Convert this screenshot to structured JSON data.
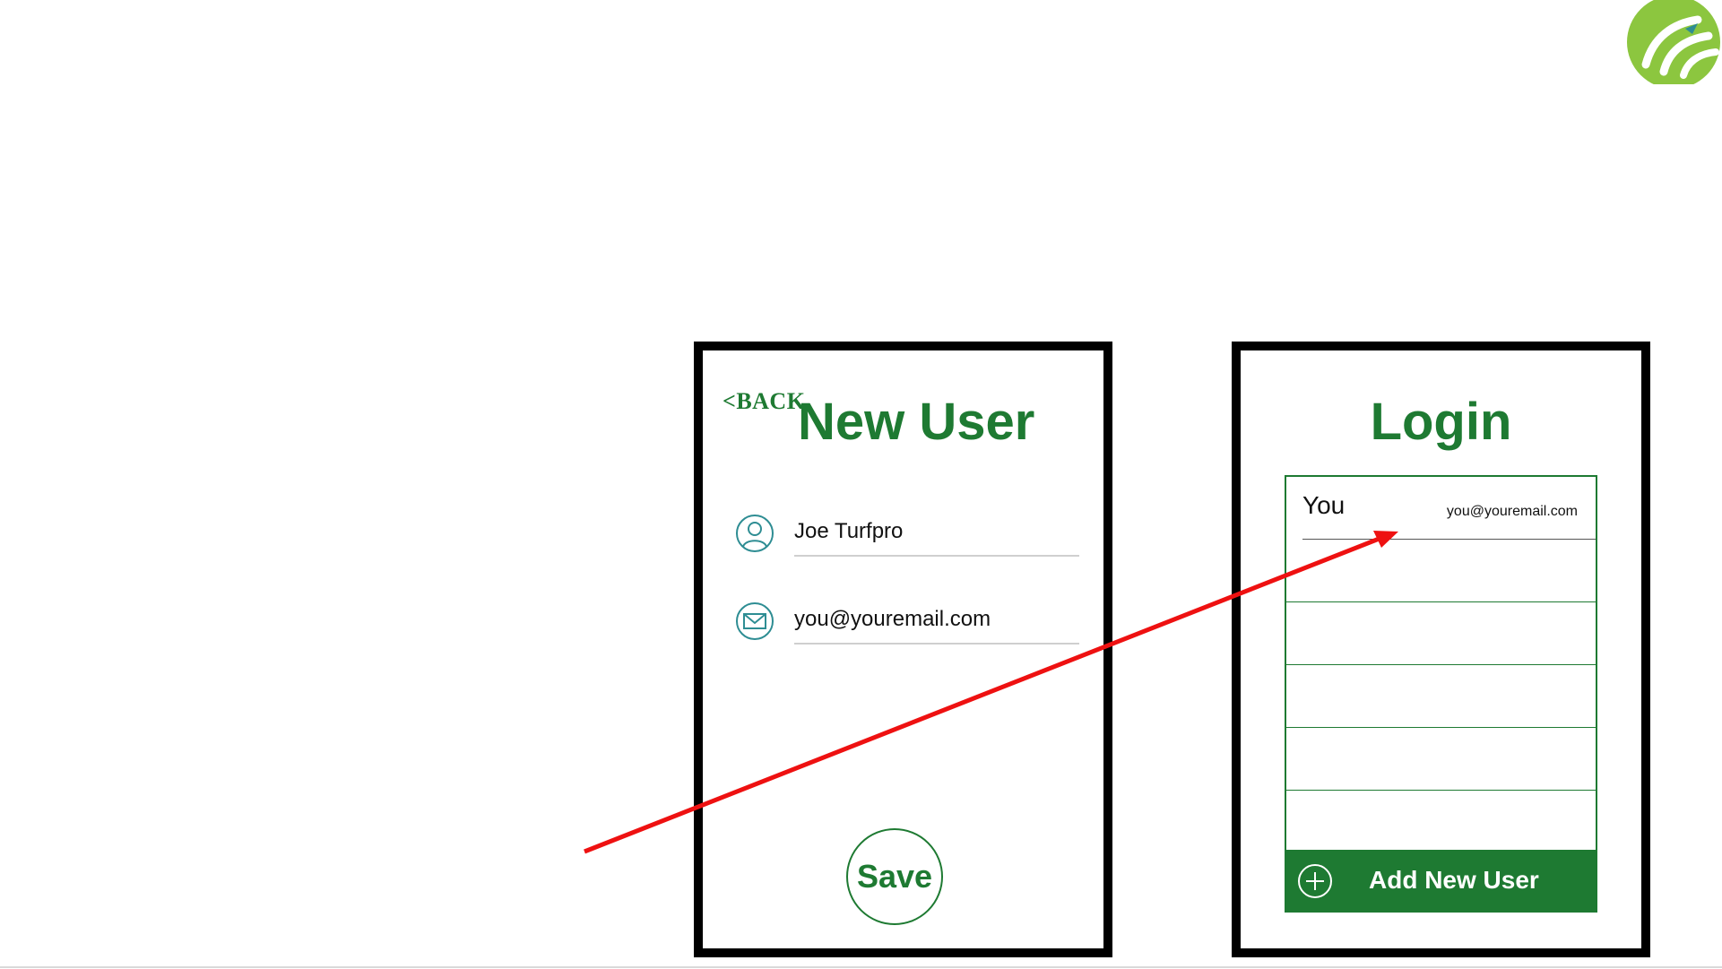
{
  "colors": {
    "accent_green": "#1e7a32",
    "logo_green": "#8cc63f",
    "icon_teal": "#2e8d93",
    "arrow_red": "#ee1111"
  },
  "logo": {
    "icon": "turf-logo-icon"
  },
  "new_user_screen": {
    "back_label": "<BACK",
    "title": "New User",
    "name_field": {
      "icon": "user-icon",
      "value": "Joe Turfpro"
    },
    "email_field": {
      "icon": "mail-icon",
      "value": "you@youremail.com"
    },
    "save_label": "Save"
  },
  "login_screen": {
    "title": "Login",
    "users": [
      {
        "name": "You",
        "email": "you@youremail.com"
      },
      {
        "name": "",
        "email": ""
      },
      {
        "name": "",
        "email": ""
      },
      {
        "name": "",
        "email": ""
      },
      {
        "name": "",
        "email": ""
      },
      {
        "name": "",
        "email": ""
      }
    ],
    "add_user_label": "Add New User",
    "add_user_icon": "plus-circle-icon"
  },
  "annotation": {
    "type": "arrow",
    "color_ref": "arrow_red"
  }
}
